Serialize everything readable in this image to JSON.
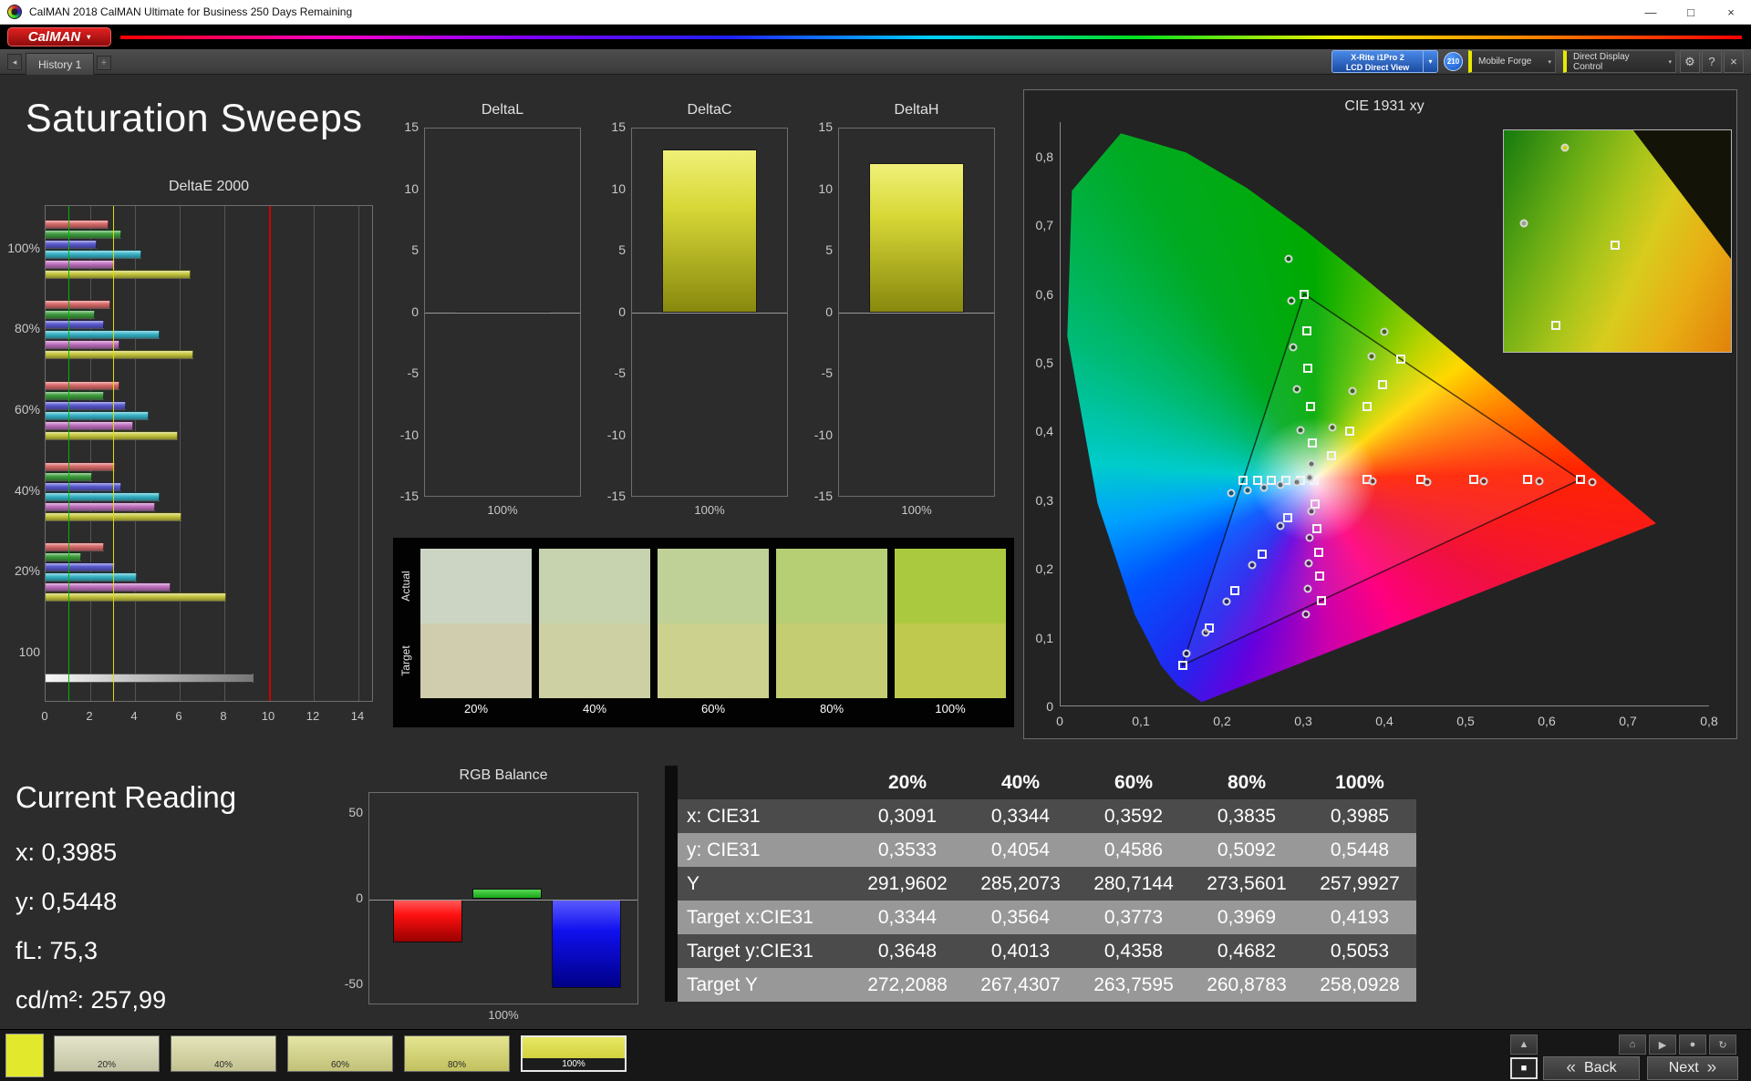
{
  "window": {
    "title": "CalMAN 2018 CalMAN Ultimate for Business 250 Days Remaining",
    "minimize": "—",
    "maximize": "□",
    "close": "×"
  },
  "brand": {
    "logo_text": "CalMAN",
    "caret": "▾"
  },
  "tabs": {
    "nav": "◂",
    "history": "History 1",
    "add": "+"
  },
  "toolbar": {
    "meter_line1": "X-Rite i1Pro 2",
    "meter_line2": "LCD Direct View",
    "caret": "▾",
    "badge": "210",
    "source": "Mobile Forge",
    "display_control": "Direct Display Control",
    "gear": "⚙",
    "help": "?",
    "close": "×"
  },
  "page": {
    "title": "Saturation Sweeps"
  },
  "deltae_chart": {
    "title": "DeltaE 2000",
    "x_ticks": [
      0,
      2,
      4,
      6,
      8,
      10,
      12,
      14
    ],
    "series": [
      "Red",
      "Green",
      "Blue",
      "Cyan",
      "Magenta",
      "Yellow"
    ],
    "series_colors": [
      "#d96a6a",
      "#3f9e3f",
      "#5a5ad0",
      "#38b4c8",
      "#c070c0",
      "#c6c63e"
    ],
    "groups": [
      {
        "label": "100%",
        "values": [
          2.8,
          3.4,
          2.3,
          4.3,
          3.1,
          6.5
        ]
      },
      {
        "label": "80%",
        "values": [
          2.9,
          2.2,
          2.6,
          5.1,
          3.3,
          6.6
        ]
      },
      {
        "label": "60%",
        "values": [
          3.3,
          2.6,
          3.6,
          4.6,
          3.9,
          5.9
        ]
      },
      {
        "label": "40%",
        "values": [
          3.1,
          2.1,
          3.4,
          5.1,
          4.9,
          6.1
        ]
      },
      {
        "label": "20%",
        "values": [
          2.6,
          1.6,
          3.1,
          4.1,
          5.6,
          8.1
        ]
      },
      {
        "label": "100",
        "values": [
          9.3
        ]
      }
    ],
    "ref_lines": {
      "green": 1,
      "yellow": 3,
      "red": 10
    }
  },
  "delta_axis": [
    "15",
    "10",
    "5",
    "0",
    "-5",
    "-10",
    "-15"
  ],
  "delta_charts": [
    {
      "title": "DeltaL",
      "value": 0.1,
      "x_label": "100%"
    },
    {
      "title": "DeltaC",
      "value": 13.3,
      "x_label": "100%"
    },
    {
      "title": "DeltaH",
      "value": 12.2,
      "x_label": "100%"
    }
  ],
  "swatches": {
    "row_labels": [
      "Actual",
      "Target"
    ],
    "columns": [
      "20%",
      "40%",
      "60%",
      "80%",
      "100%"
    ],
    "actual": [
      "#ccd5c4",
      "#c6d3ae",
      "#bfd196",
      "#b6ce74",
      "#abc93f"
    ],
    "target": [
      "#cfcdae",
      "#cdd0a2",
      "#ccd28e",
      "#c5cd73",
      "#bec94d"
    ]
  },
  "cie": {
    "title": "CIE 1931 xy",
    "x_ticks": [
      "0",
      "0,1",
      "0,2",
      "0,3",
      "0,4",
      "0,5",
      "0,6",
      "0,7",
      "0,8"
    ],
    "y_ticks": [
      "0",
      "0,1",
      "0,2",
      "0,3",
      "0,4",
      "0,5",
      "0,6",
      "0,7",
      "0,8"
    ],
    "gamut_triangle": [
      [
        0.64,
        0.33
      ],
      [
        0.3,
        0.6
      ],
      [
        0.15,
        0.06
      ]
    ],
    "targets": [
      [
        0.3127,
        0.329
      ],
      [
        0.378,
        0.33
      ],
      [
        0.444,
        0.33
      ],
      [
        0.509,
        0.33
      ],
      [
        0.575,
        0.33
      ],
      [
        0.64,
        0.33
      ],
      [
        0.31,
        0.383
      ],
      [
        0.308,
        0.437
      ],
      [
        0.305,
        0.492
      ],
      [
        0.303,
        0.546
      ],
      [
        0.3,
        0.6
      ],
      [
        0.28,
        0.275
      ],
      [
        0.248,
        0.221
      ],
      [
        0.215,
        0.168
      ],
      [
        0.183,
        0.114
      ],
      [
        0.15,
        0.06
      ],
      [
        0.295,
        0.329
      ],
      [
        0.278,
        0.329
      ],
      [
        0.26,
        0.329
      ],
      [
        0.243,
        0.329
      ],
      [
        0.225,
        0.329
      ],
      [
        0.314,
        0.294
      ],
      [
        0.316,
        0.259
      ],
      [
        0.318,
        0.224
      ],
      [
        0.319,
        0.189
      ],
      [
        0.321,
        0.154
      ],
      [
        0.334,
        0.365
      ],
      [
        0.356,
        0.401
      ],
      [
        0.377,
        0.436
      ],
      [
        0.397,
        0.468
      ],
      [
        0.419,
        0.505
      ]
    ],
    "measurements": [
      [
        0.307,
        0.333
      ],
      [
        0.384,
        0.327
      ],
      [
        0.452,
        0.326
      ],
      [
        0.521,
        0.327
      ],
      [
        0.59,
        0.328
      ],
      [
        0.655,
        0.326
      ],
      [
        0.296,
        0.402
      ],
      [
        0.291,
        0.462
      ],
      [
        0.287,
        0.522
      ],
      [
        0.284,
        0.59
      ],
      [
        0.281,
        0.651
      ],
      [
        0.271,
        0.263
      ],
      [
        0.236,
        0.206
      ],
      [
        0.204,
        0.152
      ],
      [
        0.179,
        0.108
      ],
      [
        0.155,
        0.077
      ],
      [
        0.291,
        0.326
      ],
      [
        0.271,
        0.322
      ],
      [
        0.251,
        0.318
      ],
      [
        0.23,
        0.314
      ],
      [
        0.21,
        0.311
      ],
      [
        0.309,
        0.284
      ],
      [
        0.307,
        0.246
      ],
      [
        0.306,
        0.208
      ],
      [
        0.304,
        0.171
      ],
      [
        0.302,
        0.134
      ],
      [
        0.3091,
        0.3533
      ],
      [
        0.3344,
        0.4054
      ],
      [
        0.3592,
        0.4586
      ],
      [
        0.3835,
        0.5092
      ],
      [
        0.3985,
        0.5448
      ]
    ],
    "inset_markers": [
      {
        "shape": "circle",
        "x": 27,
        "y": 8,
        "color": "#c6d40a"
      },
      {
        "shape": "circle",
        "x": 9,
        "y": 42,
        "color": "#9aa08a"
      },
      {
        "shape": "square",
        "x": 49,
        "y": 52
      },
      {
        "shape": "square",
        "x": 23,
        "y": 88
      }
    ]
  },
  "current_reading": {
    "title": "Current Reading",
    "lines": [
      "x: 0,3985",
      "y: 0,5448",
      "fL: 75,3",
      "cd/m²: 257,99"
    ]
  },
  "rgb_balance": {
    "title": "RGB Balance",
    "x_label": "100%",
    "y_ticks": [
      50,
      0,
      -50
    ],
    "bars": [
      {
        "name": "red",
        "value": -25
      },
      {
        "name": "green",
        "value": 6
      },
      {
        "name": "blue",
        "value": -52
      }
    ]
  },
  "table": {
    "columns": [
      "20%",
      "40%",
      "60%",
      "80%",
      "100%"
    ],
    "rows": [
      {
        "label": "x: CIE31",
        "values": [
          "0,3091",
          "0,3344",
          "0,3592",
          "0,3835",
          "0,3985"
        ]
      },
      {
        "label": "y: CIE31",
        "values": [
          "0,3533",
          "0,4054",
          "0,4586",
          "0,5092",
          "0,5448"
        ]
      },
      {
        "label": "Y",
        "values": [
          "291,9602",
          "285,2073",
          "280,7144",
          "273,5601",
          "257,9927"
        ]
      },
      {
        "label": "Target x:CIE31",
        "values": [
          "0,3344",
          "0,3564",
          "0,3773",
          "0,3969",
          "0,4193"
        ]
      },
      {
        "label": "Target y:CIE31",
        "values": [
          "0,3648",
          "0,4013",
          "0,4358",
          "0,4682",
          "0,5053"
        ]
      },
      {
        "label": "Target Y",
        "values": [
          "272,2088",
          "267,4307",
          "263,7595",
          "260,8783",
          "258,0928"
        ]
      }
    ]
  },
  "bottom": {
    "thumbnails": [
      {
        "label": "20%",
        "color": "#dcdcba",
        "active": false
      },
      {
        "label": "40%",
        "color": "#dcdca4",
        "active": false
      },
      {
        "label": "60%",
        "color": "#dcdc88",
        "active": false
      },
      {
        "label": "80%",
        "color": "#dcdc6c",
        "active": false
      },
      {
        "label": "100%",
        "color": "#e0e030",
        "active": true
      }
    ],
    "stop": "■",
    "back_chevron": "«",
    "back": "Back",
    "next": "Next",
    "next_chevron": "»",
    "small_buttons": [
      {
        "name": "eject-button",
        "glyph": "▲"
      },
      {
        "name": "home-button",
        "glyph": "⌂"
      },
      {
        "name": "play-button",
        "glyph": "▶"
      },
      {
        "name": "record-button",
        "glyph": "●"
      },
      {
        "name": "refresh-button",
        "glyph": "↻"
      }
    ]
  }
}
